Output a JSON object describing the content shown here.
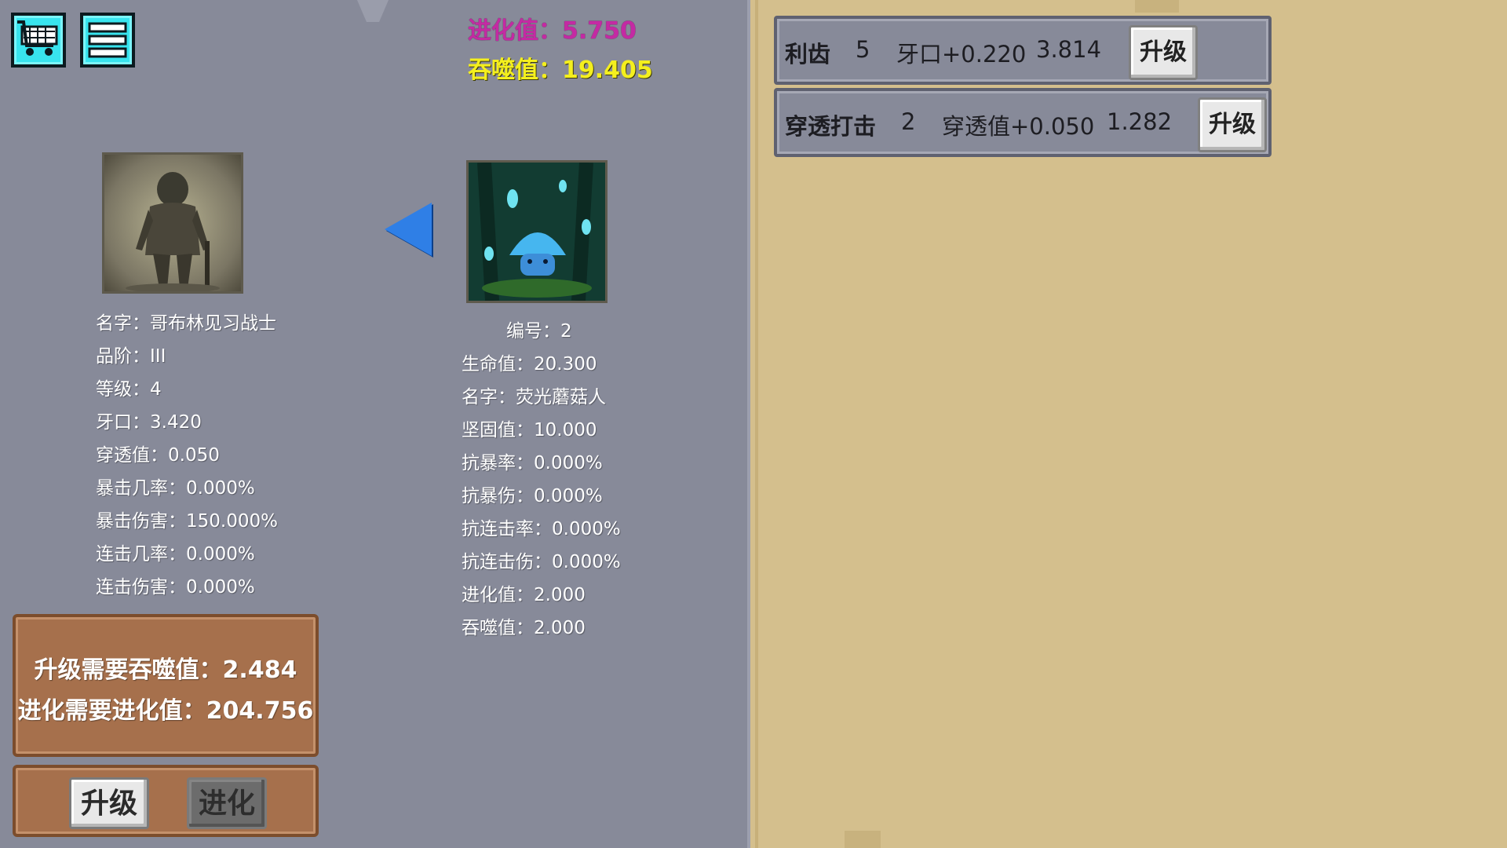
{
  "header": {
    "evolution_value": "进化值：5.750",
    "devour_value": "吞噬值：19.405"
  },
  "icons": {
    "shop": "shop-cart-icon",
    "menu": "menu-list-icon",
    "direction": "left-arrow-icon"
  },
  "player": {
    "stats": [
      "名字：哥布林见习战士",
      "品阶：III",
      "等级：4",
      "牙口：3.420",
      "穿透值：0.050",
      "暴击几率：0.000%",
      "暴击伤害：150.000%",
      "连击几率：0.000%",
      "连击伤害：0.000%"
    ]
  },
  "enemy": {
    "stats": [
      "编号：2",
      "生命值：20.300",
      "名字：荧光蘑菇人",
      "坚固值：10.000",
      "抗暴率：0.000%",
      "抗暴伤：0.000%",
      "抗连击率：0.000%",
      "抗连击伤：0.000%",
      "进化值：2.000",
      "吞噬值：2.000"
    ]
  },
  "requirements": {
    "upgrade": "升级需要吞噬值：2.484",
    "evolve": "进化需要进化值：204.756"
  },
  "actions": {
    "upgrade": "升级",
    "evolve": "进化"
  },
  "skills": [
    {
      "name": "利齿",
      "level": "5",
      "effect": "牙口+0.220",
      "cost": "3.814",
      "button": "升级"
    },
    {
      "name": "穿透打击",
      "level": "2",
      "effect": "穿透值+0.050",
      "cost": "1.282",
      "button": "升级"
    }
  ],
  "colors": {
    "left_panel": "#878a99",
    "right_panel": "#d4bf8d",
    "evolution_text": "#c42aa3",
    "devour_text": "#f4ef1e",
    "icon_button": "#38e4ee",
    "arrow": "#2f7fe6",
    "wood": "#a6704c"
  }
}
